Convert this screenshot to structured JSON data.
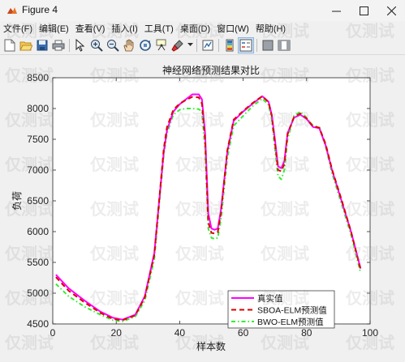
{
  "window": {
    "title": "Figure 4"
  },
  "menu": {
    "items": [
      "文件(F)",
      "编辑(E)",
      "查看(V)",
      "插入(I)",
      "工具(T)",
      "桌面(D)",
      "窗口(W)",
      "帮助(H)"
    ]
  },
  "toolbar": {
    "buttons": [
      "new-figure-icon",
      "open-file-icon",
      "save-icon",
      "print-icon",
      "arrow-pointer-icon",
      "zoom-in-icon",
      "zoom-out-icon",
      "pan-hand-icon",
      "rotate-3d-icon",
      "data-cursor-icon",
      "brush-icon",
      "link-plot-icon",
      "colorbar-icon",
      "legend-icon",
      "hide-plot-tools-icon",
      "show-plot-tools-icon"
    ]
  },
  "watermark": {
    "text": "仅测试"
  },
  "chart_data": {
    "type": "line",
    "title": "神经网络预测结果对比",
    "xlabel": "样本数",
    "ylabel": "负荷",
    "xlim": [
      0,
      100
    ],
    "ylim": [
      4500,
      8500
    ],
    "xticks": [
      0,
      20,
      40,
      60,
      80,
      100
    ],
    "yticks": [
      4500,
      5000,
      5500,
      6000,
      6500,
      7000,
      7500,
      8000,
      8500
    ],
    "grid": false,
    "legend_position": "bottom-right",
    "series": [
      {
        "name": "真实值",
        "color": "#ff00ff",
        "style": "solid",
        "x": [
          1,
          5,
          10,
          15,
          19,
          22,
          26,
          29,
          32,
          35,
          36,
          38,
          40,
          42,
          44,
          46,
          47,
          48,
          49,
          50,
          51,
          52,
          53,
          55,
          57,
          60,
          63,
          66,
          68,
          69,
          70,
          71,
          72,
          73,
          74,
          76,
          78,
          80,
          82,
          84,
          86,
          88,
          91,
          94,
          97
        ],
        "y": [
          5300,
          5080,
          4880,
          4700,
          4600,
          4570,
          4650,
          4950,
          5650,
          7300,
          7650,
          7950,
          8070,
          8150,
          8230,
          8230,
          8150,
          7600,
          6300,
          6050,
          6030,
          6050,
          6350,
          7300,
          7800,
          7950,
          8080,
          8200,
          8110,
          7900,
          7500,
          7060,
          7030,
          7150,
          7600,
          7850,
          7900,
          7830,
          7700,
          7680,
          7400,
          7000,
          6500,
          6000,
          5400
        ]
      },
      {
        "name": "SBOA-ELM预测值",
        "color": "#dd0000",
        "style": "dashed",
        "x": [
          1,
          5,
          10,
          15,
          19,
          22,
          26,
          29,
          32,
          35,
          36,
          38,
          40,
          42,
          44,
          46,
          47,
          48,
          49,
          50,
          51,
          52,
          53,
          55,
          57,
          60,
          63,
          66,
          68,
          69,
          70,
          71,
          72,
          73,
          74,
          76,
          78,
          80,
          82,
          84,
          86,
          88,
          91,
          94,
          97
        ],
        "y": [
          5260,
          5040,
          4850,
          4680,
          4580,
          4560,
          4640,
          4930,
          5620,
          7350,
          7700,
          7980,
          8080,
          8140,
          8190,
          8180,
          8080,
          7500,
          6150,
          5980,
          5970,
          5990,
          6300,
          7320,
          7820,
          7960,
          8090,
          8200,
          8100,
          7880,
          7450,
          7000,
          6980,
          7100,
          7580,
          7860,
          7920,
          7840,
          7710,
          7690,
          7420,
          7010,
          6520,
          6000,
          5380
        ]
      },
      {
        "name": "BWO-ELM预测值",
        "color": "#33ee33",
        "style": "dashdot",
        "x": [
          1,
          5,
          10,
          15,
          19,
          22,
          26,
          29,
          32,
          35,
          36,
          38,
          40,
          42,
          44,
          46,
          47,
          48,
          49,
          50,
          51,
          52,
          53,
          55,
          57,
          60,
          63,
          66,
          68,
          69,
          70,
          71,
          72,
          73,
          74,
          76,
          78,
          80,
          82,
          84,
          86,
          88,
          91,
          94,
          97
        ],
        "y": [
          5150,
          4950,
          4780,
          4650,
          4560,
          4540,
          4620,
          4880,
          5550,
          7250,
          7600,
          7900,
          7980,
          8000,
          8000,
          7990,
          7950,
          7350,
          6050,
          5900,
          5880,
          5900,
          6200,
          7200,
          7720,
          7880,
          8040,
          8160,
          8060,
          7820,
          7350,
          6900,
          6850,
          7000,
          7500,
          7880,
          7950,
          7850,
          7720,
          7700,
          7380,
          6950,
          6450,
          5950,
          5330
        ]
      }
    ]
  }
}
